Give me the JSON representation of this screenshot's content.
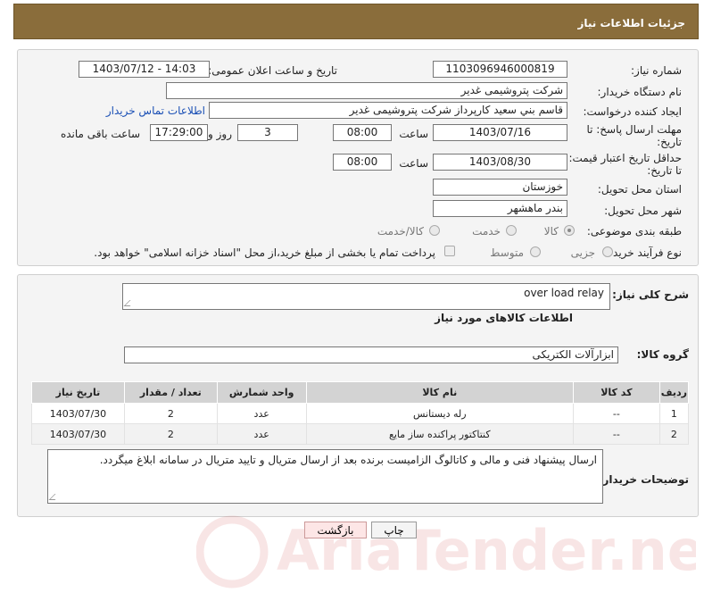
{
  "header": {
    "title": "جزئیات اطلاعات نیاز"
  },
  "form": {
    "need_number": {
      "label": "شماره نیاز:",
      "value": "1103096946000819"
    },
    "announce_datetime": {
      "label": "تاریخ و ساعت اعلان عمومی:",
      "value": "1403/07/12 - 14:03"
    },
    "buyer_org": {
      "label": "نام دستگاه خریدار:",
      "value": "شرکت پتروشیمی غدیر"
    },
    "requester": {
      "label": "ایجاد کننده درخواست:",
      "value": "قاسم بني سعيد كارپرداز شركت پتروشیمی غدير"
    },
    "contact_link": "اطلاعات تماس خریدار",
    "reply_deadline": {
      "label": "مهلت ارسال پاسخ: تا تاریخ:",
      "date": "1403/07/16",
      "time_label": "ساعت",
      "time": "08:00",
      "days": "3",
      "days_label": "روز و",
      "remaining_time": "17:29:00",
      "remaining_label": "ساعت باقی مانده"
    },
    "price_validity": {
      "label": "حداقل تاریخ اعتبار قیمت: تا تاریخ:",
      "date": "1403/08/30",
      "time_label": "ساعت",
      "time": "08:00"
    },
    "delivery_province": {
      "label": "استان محل تحویل:",
      "value": "خوزستان"
    },
    "delivery_city": {
      "label": "شهر محل تحویل:",
      "value": "بندر ماهشهر"
    },
    "category": {
      "label": "طبقه بندی موضوعی:",
      "options": [
        "کالا",
        "خدمت",
        "کالا/خدمت"
      ],
      "selected": "کالا"
    },
    "purchase_process": {
      "label": "نوع فرآیند خرید :",
      "options": [
        "جزیی",
        "متوسط"
      ],
      "payment_note": "پرداخت تمام یا بخشی از مبلغ خرید،از محل \"اسناد خزانه اسلامی\" خواهد بود."
    }
  },
  "details": {
    "general_description_label": "شرح کلی نیاز:",
    "general_description": "over load relay",
    "goods_info_title": "اطلاعات کالاهای مورد نیاز",
    "goods_group_label": "گروه کالا:",
    "goods_group": "ابزارآلات الکتریکی",
    "table": {
      "headers": [
        "ردیف",
        "کد کالا",
        "نام کالا",
        "واحد شمارش",
        "تعداد / مقدار",
        "تاریخ نیاز"
      ],
      "rows": [
        [
          "1",
          "--",
          "رله دیستانس",
          "عدد",
          "2",
          "1403/07/30"
        ],
        [
          "2",
          "--",
          "کنتاکتور پراکنده ساز مایع",
          "عدد",
          "2",
          "1403/07/30"
        ]
      ]
    },
    "buyer_notes_label": "توضیحات خریدار:",
    "buyer_notes": "ارسال پیشنهاد فنی و مالی و کاتالوگ الزامیست برنده بعد از ارسال متریال و تایید متریال در سامانه ابلاغ میگردد."
  },
  "buttons": {
    "print": "چاپ",
    "back": "بازگشت"
  },
  "watermark_text": "AriaTender.net"
}
